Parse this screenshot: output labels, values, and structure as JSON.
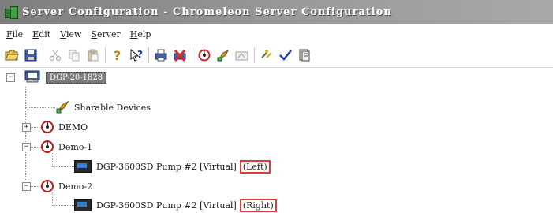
{
  "window": {
    "title": "Server Configuration - Chromeleon Server Configuration"
  },
  "menu": {
    "items": [
      {
        "hot": "F",
        "rest": "ile"
      },
      {
        "hot": "E",
        "rest": "dit"
      },
      {
        "hot": "V",
        "rest": "iew"
      },
      {
        "hot": "S",
        "rest": "erver"
      },
      {
        "hot": "H",
        "rest": "elp"
      }
    ]
  },
  "toolbar": {
    "icons": [
      "open-folder-icon",
      "save-icon",
      "cut-icon",
      "copy-icon",
      "paste-icon",
      "help-icon",
      "context-help-icon",
      "print-icon",
      "delete-icon",
      "add-instrument-icon",
      "add-module-icon",
      "properties-icon",
      "link-icon",
      "check-icon",
      "report-icon"
    ]
  },
  "tree": {
    "server": "DGP-20-1828",
    "sharable": "Sharable Devices",
    "instruments": [
      {
        "name": "DEMO",
        "expanded": false
      },
      {
        "name": "Demo-1",
        "expanded": true,
        "child": {
          "label": "DGP-3600SD Pump #2 [Virtual]",
          "tag": "(Left)"
        }
      },
      {
        "name": "Demo-2",
        "expanded": true,
        "child": {
          "label": "DGP-3600SD Pump #2 [Virtual]",
          "tag": "(Right)"
        }
      }
    ]
  },
  "colors": {
    "title_bar": "#8c8c8c",
    "highlight_box": "#e53935",
    "instrument_ring": "#b71c1c"
  }
}
